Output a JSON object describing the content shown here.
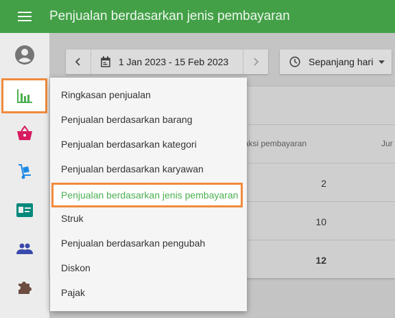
{
  "appbar": {
    "title": "Penjualan berdasarkan jenis pembayaran",
    "menu_icon": "hamburger-icon"
  },
  "sidebar": {
    "items": [
      {
        "name": "account-icon",
        "color": "#757575"
      },
      {
        "name": "bar-chart-icon",
        "color": "#4caf50",
        "active": true
      },
      {
        "name": "basket-icon",
        "color": "#d81b60"
      },
      {
        "name": "hand-truck-icon",
        "color": "#1e88e5"
      },
      {
        "name": "id-card-icon",
        "color": "#00897b"
      },
      {
        "name": "people-icon",
        "color": "#3949ab"
      },
      {
        "name": "puzzle-icon",
        "color": "#6d4c41"
      }
    ]
  },
  "toolbar": {
    "date_range": "1 Jan 2023 - 15 Feb 2023",
    "time_filter": "Sepanjang hari"
  },
  "table": {
    "headers": [
      "nsaksi pembayaran",
      "Jur"
    ],
    "rows": [
      "2",
      "10"
    ],
    "total": "12"
  },
  "dropdown_menu": {
    "items": [
      "Ringkasan penjualan",
      "Penjualan berdasarkan barang",
      "Penjualan berdasarkan kategori",
      "Penjualan berdasarkan karyawan",
      "Penjualan berdasarkan jenis pembayaran",
      "Struk",
      "Penjualan berdasarkan pengubah",
      "Diskon",
      "Pajak"
    ],
    "selected_index": 4
  }
}
